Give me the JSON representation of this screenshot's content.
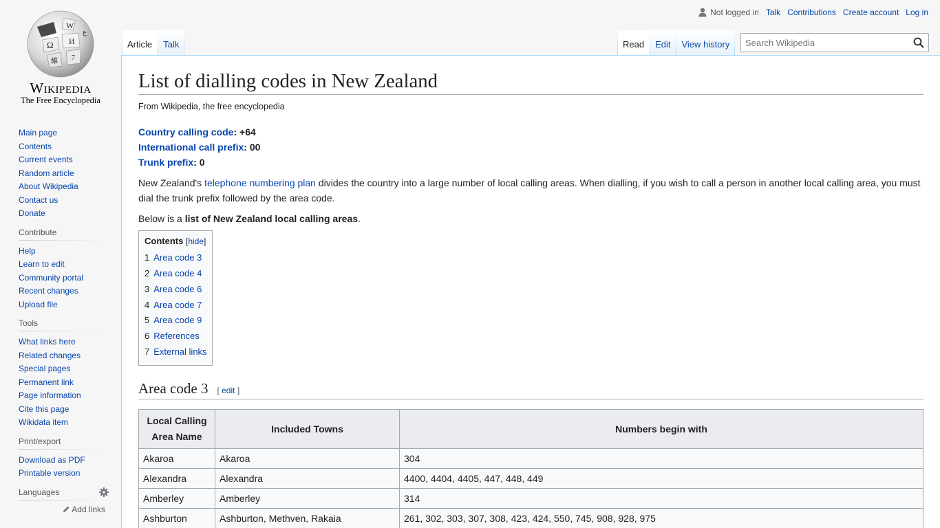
{
  "logo": {
    "wordmark": "Wikipedia",
    "tagline": "The Free Encyclopedia"
  },
  "personal": {
    "not_logged_in": "Not logged in",
    "talk": "Talk",
    "contributions": "Contributions",
    "create_account": "Create account",
    "log_in": "Log in"
  },
  "tabs": {
    "article": "Article",
    "talk": "Talk",
    "read": "Read",
    "edit": "Edit",
    "view_history": "View history"
  },
  "search": {
    "placeholder": "Search Wikipedia"
  },
  "sidebar": {
    "navigation": [
      "Main page",
      "Contents",
      "Current events",
      "Random article",
      "About Wikipedia",
      "Contact us",
      "Donate"
    ],
    "contribute": {
      "heading": "Contribute",
      "items": [
        "Help",
        "Learn to edit",
        "Community portal",
        "Recent changes",
        "Upload file"
      ]
    },
    "tools": {
      "heading": "Tools",
      "items": [
        "What links here",
        "Related changes",
        "Special pages",
        "Permanent link",
        "Page information",
        "Cite this page",
        "Wikidata item"
      ]
    },
    "print": {
      "heading": "Print/export",
      "items": [
        "Download as PDF",
        "Printable version"
      ]
    },
    "languages": {
      "heading": "Languages",
      "add_links": "Add links"
    }
  },
  "article": {
    "title": "List of dialling codes in New Zealand",
    "site_sub": "From Wikipedia, the free encyclopedia",
    "infos": [
      {
        "label": "Country calling code",
        "value": ": +64"
      },
      {
        "label": "International call prefix",
        "value": ": 00"
      },
      {
        "label": "Trunk prefix",
        "value": ": 0"
      }
    ],
    "intro": {
      "before": "New Zealand's ",
      "link": "telephone numbering plan",
      "after": " divides the country into a large number of local calling areas. When dialling, if you wish to call a person in another local calling area, you must dial the trunk prefix followed by the area code."
    },
    "below": {
      "before": "Below is a ",
      "bold": "list of New Zealand local calling areas",
      "after": "."
    },
    "toc": {
      "title": "Contents",
      "hide_open": "[",
      "hide": "hide",
      "hide_close": "]",
      "items": [
        {
          "num": "1",
          "label": "Area code 3"
        },
        {
          "num": "2",
          "label": "Area code 4"
        },
        {
          "num": "3",
          "label": "Area code 6"
        },
        {
          "num": "4",
          "label": "Area code 7"
        },
        {
          "num": "5",
          "label": "Area code 9"
        },
        {
          "num": "6",
          "label": "References"
        },
        {
          "num": "7",
          "label": "External links"
        }
      ]
    },
    "section1": {
      "heading": "Area code 3",
      "edit_open": "[ ",
      "edit": "edit",
      "edit_close": " ]"
    },
    "table": {
      "headers": [
        "Local Calling Area Name",
        "Included Towns",
        "Numbers begin with"
      ],
      "rows": [
        [
          "Akaroa",
          "Akaroa",
          "304"
        ],
        [
          "Alexandra",
          "Alexandra",
          "4400, 4404, 4405, 447, 448, 449"
        ],
        [
          "Amberley",
          "Amberley",
          "314"
        ],
        [
          "Ashburton",
          "Ashburton, Methven, Rakaia",
          "261, 302, 303, 307, 308, 423, 424, 550, 745, 908, 928, 975"
        ]
      ]
    }
  }
}
